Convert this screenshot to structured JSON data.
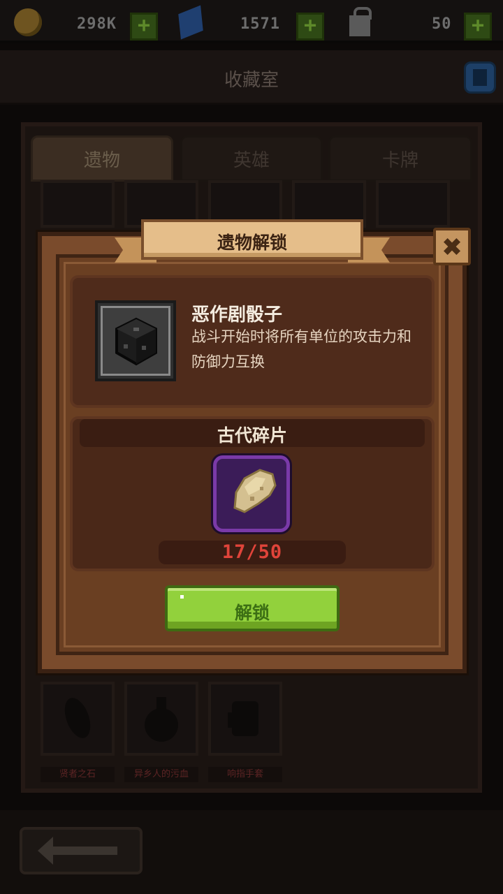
{
  "resources": [
    {
      "name": "gold",
      "icon": "coin-icon",
      "value": "298K"
    },
    {
      "name": "gems",
      "icon": "gem-icon",
      "value": "1571"
    },
    {
      "name": "keys",
      "icon": "lock-icon",
      "value": "50"
    }
  ],
  "plus_label": "+",
  "header": {
    "title": "收藏室"
  },
  "tabs": [
    {
      "label": "遗物",
      "active": true
    },
    {
      "label": "英雄",
      "active": false
    },
    {
      "label": "卡牌",
      "active": false
    }
  ],
  "collection_bottom_items": [
    "贤者之石",
    "异乡人的污血",
    "响指手套"
  ],
  "modal": {
    "title": "遗物解锁",
    "relic": {
      "name": "恶作剧骰子",
      "description": "战斗开始时将所有单位的攻击力和防御力互换",
      "icon": "dark-dice-icon"
    },
    "material": {
      "title": "古代碎片",
      "icon": "ancient-shard-icon",
      "count": "17/50",
      "owned": 17,
      "required": 50
    },
    "unlock_label": "解锁"
  },
  "colors": {
    "unlock_button": "#92d13c",
    "count_text": "#e0443a",
    "shard_frame": "#7a3aa8",
    "ribbon": "#e5be8a"
  }
}
